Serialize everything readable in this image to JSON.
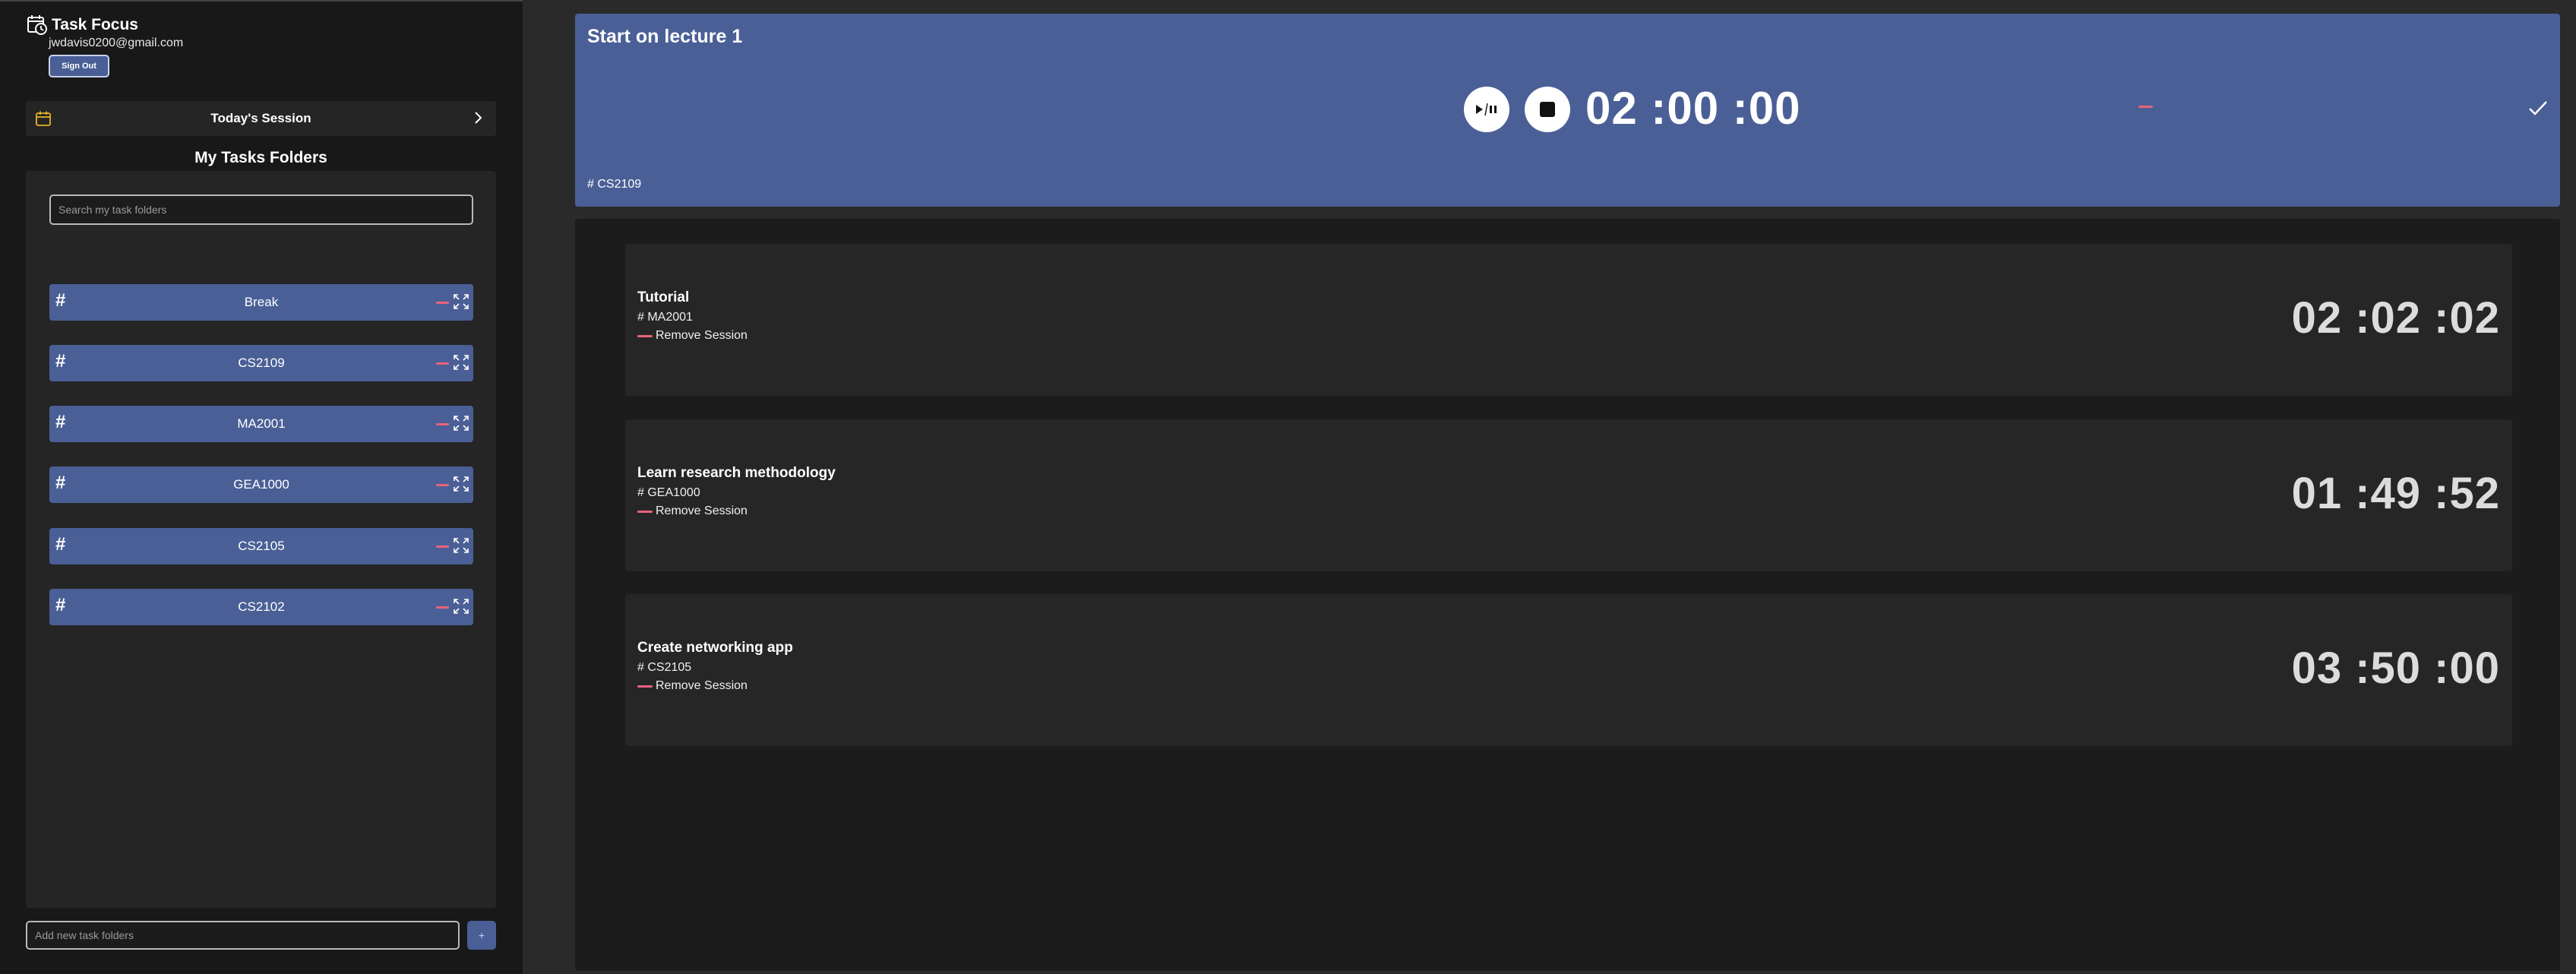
{
  "app": {
    "title": "Task Focus",
    "email": "jwdavis0200@gmail.com",
    "sign_out_label": "Sign Out"
  },
  "today": {
    "label": "Today's Session"
  },
  "folders": {
    "title": "My Tasks Folders",
    "search_placeholder": "Search my task folders",
    "items": [
      {
        "label": "Break"
      },
      {
        "label": "CS2109"
      },
      {
        "label": "MA2001"
      },
      {
        "label": "GEA1000"
      },
      {
        "label": "CS2105"
      },
      {
        "label": "CS2102"
      }
    ],
    "hash_symbol": "#",
    "add_placeholder": "Add new task folders",
    "add_button_label": "+"
  },
  "active": {
    "title": "Start on lecture 1",
    "tag": "# CS2109",
    "timer": "02 :00 :00"
  },
  "sessions": [
    {
      "title": "Tutorial",
      "tag": "# MA2001",
      "remove_label": "Remove Session",
      "timer": "02 :02 :02"
    },
    {
      "title": "Learn research methodology",
      "tag": "# GEA1000",
      "remove_label": "Remove Session",
      "timer": "01 :49 :52"
    },
    {
      "title": "Create networking app",
      "tag": "# CS2105",
      "remove_label": "Remove Session",
      "timer": "03 :50 :00"
    }
  ],
  "colors": {
    "accent": "#4a5f96",
    "remove": "#e8647a",
    "calendar_icon": "#e6b422"
  },
  "icons": {
    "brand": "clock-calendar-icon",
    "today": "calendar-icon",
    "today_arrow": "chevron-right-icon",
    "folder_remove": "minus-icon",
    "folder_open": "expand-icon",
    "play_pause": "play-pause-icon",
    "stop": "stop-icon",
    "complete": "check-icon"
  }
}
